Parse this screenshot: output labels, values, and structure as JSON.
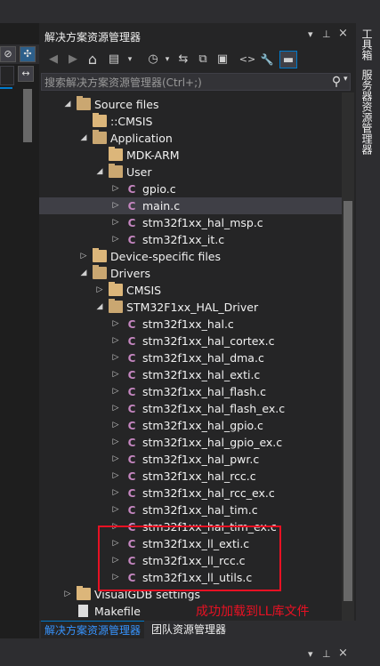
{
  "panel": {
    "title": "解决方案资源管理器",
    "pin_glyph": "▾",
    "pin2_glyph": "ᚬ",
    "close_glyph": "×",
    "search_placeholder": "搜索解决方案资源管理器(Ctrl+;)"
  },
  "left_strip": {
    "btn1": "⊘",
    "btn2": "↔",
    "btn3": "✣"
  },
  "toolbar": {
    "icons": [
      "back-icon",
      "forward-icon",
      "home-icon",
      "switch-views-icon",
      "history-icon",
      "sync-icon",
      "collapse-all-icon",
      "show-all-files-icon",
      "view-code-icon",
      "properties-icon",
      "preview-icon"
    ],
    "glyphs": [
      "◀",
      "▶",
      "⌂",
      "▤",
      "◷",
      "⇆",
      "⧉",
      "▣",
      "<>",
      "🔧",
      "▬"
    ]
  },
  "tree": {
    "rows": [
      {
        "label": "Source files",
        "arrow": "◢",
        "icon": "folder-open",
        "depth": 1
      },
      {
        "label": "::CMSIS",
        "arrow": "",
        "icon": "folder",
        "depth": 2
      },
      {
        "label": "Application",
        "arrow": "◢",
        "icon": "folder-open",
        "depth": 2
      },
      {
        "label": "MDK-ARM",
        "arrow": "",
        "icon": "folder",
        "depth": 3
      },
      {
        "label": "User",
        "arrow": "◢",
        "icon": "folder-open",
        "depth": 3
      },
      {
        "label": "gpio.c",
        "arrow": "▷",
        "icon": "c-file",
        "depth": 4
      },
      {
        "label": "main.c",
        "arrow": "▷",
        "icon": "c-file",
        "depth": 4,
        "selected": true
      },
      {
        "label": "stm32f1xx_hal_msp.c",
        "arrow": "▷",
        "icon": "c-file",
        "depth": 4
      },
      {
        "label": "stm32f1xx_it.c",
        "arrow": "▷",
        "icon": "c-file",
        "depth": 4
      },
      {
        "label": "Device-specific files",
        "arrow": "▷",
        "icon": "folder",
        "depth": 2
      },
      {
        "label": "Drivers",
        "arrow": "◢",
        "icon": "folder-open",
        "depth": 2
      },
      {
        "label": "CMSIS",
        "arrow": "▷",
        "icon": "folder",
        "depth": 3
      },
      {
        "label": "STM32F1xx_HAL_Driver",
        "arrow": "◢",
        "icon": "folder-open",
        "depth": 3
      },
      {
        "label": "stm32f1xx_hal.c",
        "arrow": "▷",
        "icon": "c-file",
        "depth": 4
      },
      {
        "label": "stm32f1xx_hal_cortex.c",
        "arrow": "▷",
        "icon": "c-file",
        "depth": 4
      },
      {
        "label": "stm32f1xx_hal_dma.c",
        "arrow": "▷",
        "icon": "c-file",
        "depth": 4
      },
      {
        "label": "stm32f1xx_hal_exti.c",
        "arrow": "▷",
        "icon": "c-file",
        "depth": 4
      },
      {
        "label": "stm32f1xx_hal_flash.c",
        "arrow": "▷",
        "icon": "c-file",
        "depth": 4
      },
      {
        "label": "stm32f1xx_hal_flash_ex.c",
        "arrow": "▷",
        "icon": "c-file",
        "depth": 4
      },
      {
        "label": "stm32f1xx_hal_gpio.c",
        "arrow": "▷",
        "icon": "c-file",
        "depth": 4
      },
      {
        "label": "stm32f1xx_hal_gpio_ex.c",
        "arrow": "▷",
        "icon": "c-file",
        "depth": 4
      },
      {
        "label": "stm32f1xx_hal_pwr.c",
        "arrow": "▷",
        "icon": "c-file",
        "depth": 4
      },
      {
        "label": "stm32f1xx_hal_rcc.c",
        "arrow": "▷",
        "icon": "c-file",
        "depth": 4
      },
      {
        "label": "stm32f1xx_hal_rcc_ex.c",
        "arrow": "▷",
        "icon": "c-file",
        "depth": 4
      },
      {
        "label": "stm32f1xx_hal_tim.c",
        "arrow": "▷",
        "icon": "c-file",
        "depth": 4
      },
      {
        "label": "stm32f1xx_hal_tim_ex.c",
        "arrow": "▷",
        "icon": "c-file",
        "depth": 4
      },
      {
        "label": "stm32f1xx_ll_exti.c",
        "arrow": "▷",
        "icon": "c-file",
        "depth": 4
      },
      {
        "label": "stm32f1xx_ll_rcc.c",
        "arrow": "▷",
        "icon": "c-file",
        "depth": 4
      },
      {
        "label": "stm32f1xx_ll_utils.c",
        "arrow": "▷",
        "icon": "c-file",
        "depth": 4
      },
      {
        "label": "VisualGDB settings",
        "arrow": "▷",
        "icon": "folder",
        "depth": 1
      },
      {
        "label": "Makefile",
        "arrow": "",
        "icon": "doc-file",
        "depth": 1
      }
    ]
  },
  "tabs": {
    "solution": "解决方案资源管理器",
    "team": "团队资源管理器"
  },
  "right_tabs": {
    "toolbox": "工具箱",
    "server_explorer": "服务器资源管理器"
  },
  "annotation": {
    "note": "成功加载到LL库文件",
    "color": "#e81123"
  },
  "colors": {
    "accent": "#007acc",
    "panel_bg": "#252526",
    "chrome_bg": "#2d2d30",
    "folder": "#dcb67a",
    "c_file": "#c586c0"
  }
}
